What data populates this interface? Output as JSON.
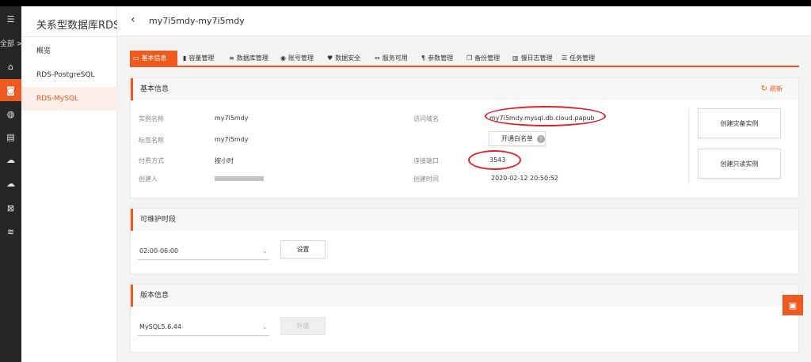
{
  "rail": {
    "label": "全部 >",
    "icons": [
      "menu-icon",
      "home-icon",
      "database-icon",
      "globe-icon",
      "storage-icon",
      "cloud-upload-icon",
      "cloud-icon",
      "close-box-icon",
      "stack-icon"
    ]
  },
  "sidebar": {
    "title": "关系型数据库RDS",
    "items": [
      {
        "label": "概览"
      },
      {
        "label": "RDS-PostgreSQL"
      },
      {
        "label": "RDS-MySQL"
      }
    ]
  },
  "header": {
    "back": "‹",
    "title": "my7i5mdy-my7i5mdy"
  },
  "tabs": [
    {
      "label": "基本信息",
      "icon": "▭"
    },
    {
      "label": "容量管理",
      "icon": "▮"
    },
    {
      "label": "数据库管理",
      "icon": "≡"
    },
    {
      "label": "账号管理",
      "icon": "◉"
    },
    {
      "label": "数据安全",
      "icon": "♥"
    },
    {
      "label": "服务可用",
      "icon": "⇔"
    },
    {
      "label": "参数管理",
      "icon": "¶"
    },
    {
      "label": "备份管理",
      "icon": "❐"
    },
    {
      "label": "慢日志管理",
      "icon": "▥"
    },
    {
      "label": "任务管理",
      "icon": "☰"
    }
  ],
  "basic": {
    "title": "基本信息",
    "refresh": "刷新",
    "instance_name_label": "实例名称",
    "instance_name": "my7i5mdy",
    "tag_name_label": "标签名称",
    "tag_name": "my7i5mdy",
    "billing_label": "付费方式",
    "billing": "按小时",
    "creator_label": "创建人",
    "creator": "",
    "domain_label": "访问域名",
    "domain": "my7i5mdy.mysql.db.cloud.papub",
    "whitelist_button": "开通白名单",
    "help": "?",
    "port_label": "连接端口",
    "port": "3543",
    "created_label": "创建时间",
    "created": "2020-02-12 20:50:52",
    "create_standby": "创建灾备实例",
    "create_readonly": "创建只读实例"
  },
  "maintenance": {
    "title": "可维护时段",
    "window": "02:00-06:00",
    "set_button": "设置"
  },
  "version": {
    "title": "版本信息",
    "value": "MySQL5.6.44",
    "upgrade_button": "升级"
  },
  "colors": {
    "accent": "#ec5a1f",
    "annotation": "#e0242a"
  }
}
